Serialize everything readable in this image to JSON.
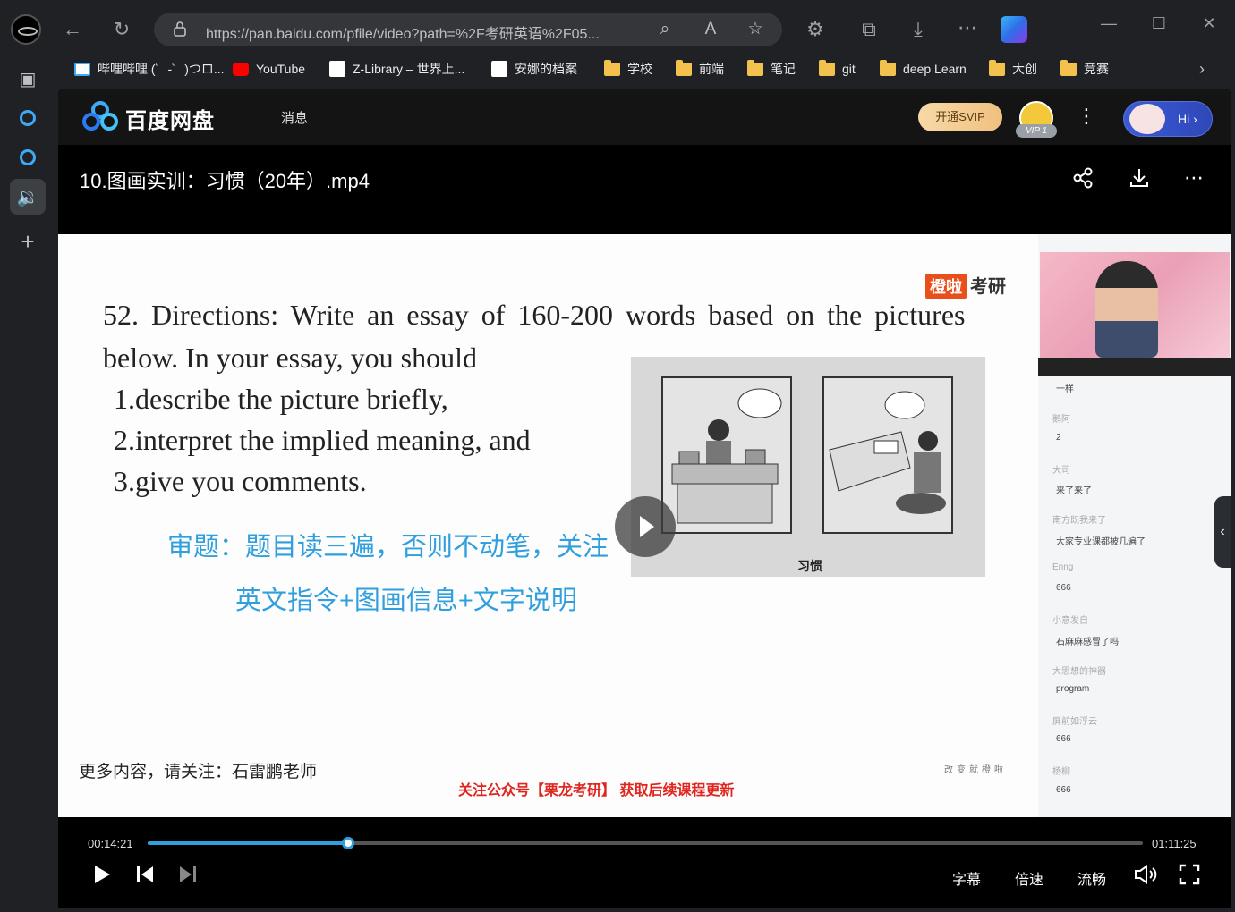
{
  "browser": {
    "url": "https://pan.baidu.com/pfile/video?path=%2F考研英语%2F05...",
    "bookmarks": [
      {
        "label": "哔哩哔哩 (゜-゜)つロ..."
      },
      {
        "label": "YouTube"
      },
      {
        "label": "Z-Library – 世界上..."
      },
      {
        "label": "安娜的档案"
      },
      {
        "label": "学校"
      },
      {
        "label": "前端"
      },
      {
        "label": "笔记"
      },
      {
        "label": "git"
      },
      {
        "label": "deep Learn"
      },
      {
        "label": "大创"
      },
      {
        "label": "竞赛"
      }
    ]
  },
  "app": {
    "logo": "百度网盘",
    "nav_message": "消息",
    "svip_button": "开通SVIP",
    "vip_badge": "VIP 1",
    "hi_button": "Hi ›",
    "video_title": "10.图画实训：习惯（20年）.mp4"
  },
  "slide": {
    "brand_tag": "橙啦",
    "brand_text": "考研",
    "directions_line1": "52. Directions: Write an essay of 160-200 words based on the pictures",
    "directions_line2": "below. In your essay, you should",
    "item1": "1.describe the picture briefly,",
    "item2": "2.interpret the implied meaning, and",
    "item3": "3.give you comments.",
    "blue_line1": "审题：题目读三遍，否则不动笔，关注",
    "blue_line2": "英文指令+图画信息+文字说明",
    "cartoon_caption": "习惯",
    "footer_left": "更多内容，请关注：石雷鹏老师",
    "footer_red": "关注公众号【栗龙考研】 获取后续课程更新",
    "footer_right": "改变就橙啦"
  },
  "chat": [
    {
      "name": "",
      "msg": "一样"
    },
    {
      "name": "鹅阿",
      "msg": "2"
    },
    {
      "name": "大司",
      "msg": "来了来了"
    },
    {
      "name": "南方既我来了",
      "msg": "大家专业课都被几遍了"
    },
    {
      "name": "Enng",
      "msg": "666"
    },
    {
      "name": "小意发自",
      "msg": "石麻麻感冒了吗"
    },
    {
      "name": "大思想的神器",
      "msg": "program"
    },
    {
      "name": "屏前如浮云",
      "msg": "666"
    },
    {
      "name": "杨柳",
      "msg": "666"
    }
  ],
  "player": {
    "time_current": "00:14:21",
    "time_total": "01:11:25",
    "progress": 0.201,
    "subtitle": "字幕",
    "speed": "倍速",
    "quality": "流畅"
  },
  "colors": {
    "accent_blue": "#2f9fde",
    "brand_orange": "#e94f1a",
    "red_text": "#e0251f"
  }
}
